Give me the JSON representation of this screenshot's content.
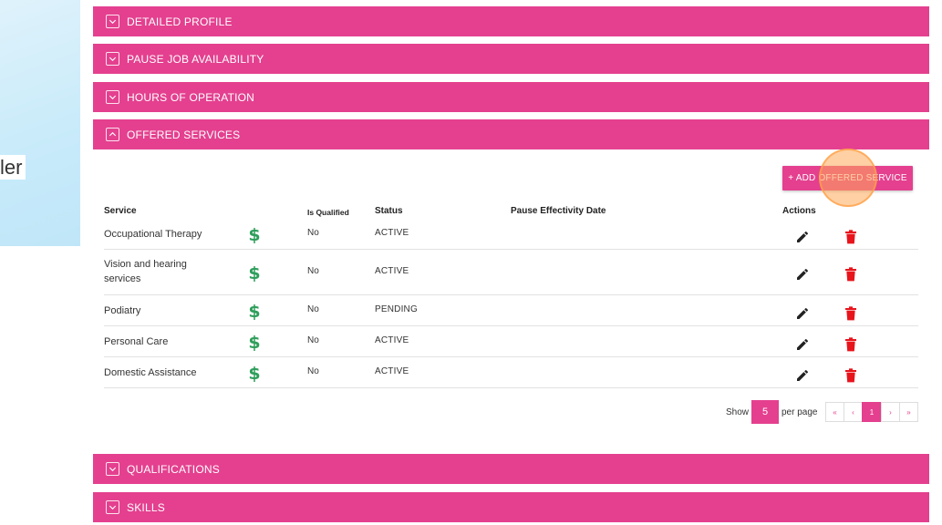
{
  "left": {
    "partial_text": "ler"
  },
  "accordions": {
    "detailed_profile": "DETAILED PROFILE",
    "pause_job": "PAUSE JOB AVAILABILITY",
    "hours": "HOURS OF OPERATION",
    "offered_services": "OFFERED SERVICES",
    "qualifications": "QUALIFICATIONS",
    "skills": "SKILLS"
  },
  "services": {
    "add_button": "+ ADD OFFERED SERVICE",
    "headers": {
      "service": "Service",
      "is_qualified": "Is Qualified",
      "status": "Status",
      "pause_date": "Pause Effectivity Date",
      "actions": "Actions"
    },
    "rows": [
      {
        "service": "Occupational Therapy",
        "qualified": "No",
        "status": "ACTIVE"
      },
      {
        "service": "Vision and hearing services",
        "qualified": "No",
        "status": "ACTIVE"
      },
      {
        "service": "Podiatry",
        "qualified": "No",
        "status": "PENDING"
      },
      {
        "service": "Personal Care",
        "qualified": "No",
        "status": "ACTIVE"
      },
      {
        "service": "Domestic Assistance",
        "qualified": "No",
        "status": "ACTIVE"
      }
    ]
  },
  "pagination": {
    "show_label": "Show",
    "per_page_value": "5",
    "per_page_label": "per page",
    "first": "«",
    "prev": "‹",
    "current": "1",
    "next": "›",
    "last": "»"
  },
  "colors": {
    "accent": "#e4408f",
    "dollar": "#2e9e5b",
    "delete": "#e8141c"
  }
}
